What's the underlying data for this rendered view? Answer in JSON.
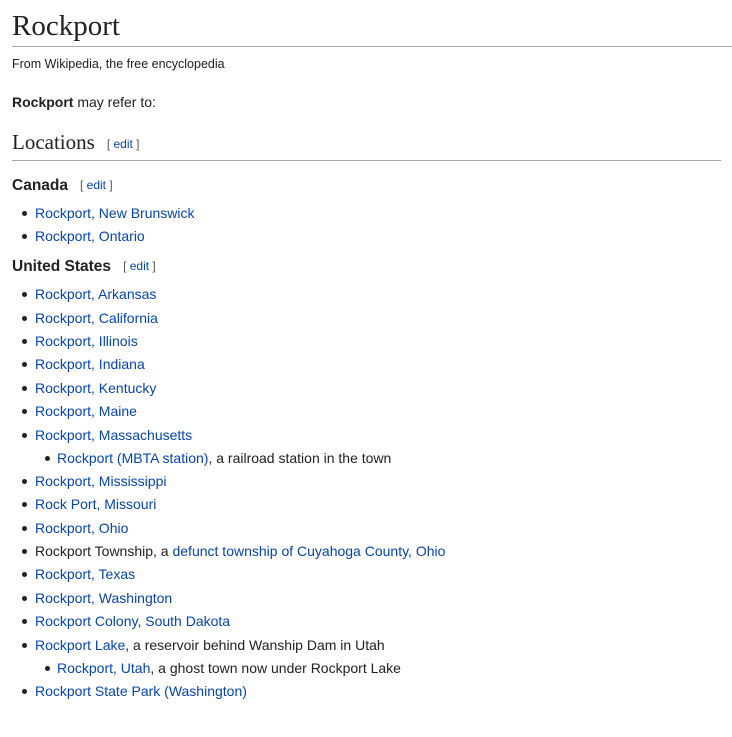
{
  "page": {
    "title": "Rockport",
    "tagline": "From Wikipedia, the free encyclopedia",
    "intro_bold": "Rockport",
    "intro_rest": " may refer to:"
  },
  "sections": {
    "locations": {
      "heading": "Locations",
      "edit_open": "[ ",
      "edit_label": "edit",
      "edit_close": " ]"
    },
    "canada": {
      "heading": "Canada",
      "edit_label": "edit",
      "items": [
        {
          "link": "Rockport, New Brunswick"
        },
        {
          "link": "Rockport, Ontario"
        }
      ]
    },
    "us": {
      "heading": "United States",
      "edit_label": "edit",
      "items": [
        {
          "link": "Rockport, Arkansas"
        },
        {
          "link": "Rockport, California"
        },
        {
          "link": "Rockport, Illinois"
        },
        {
          "link": "Rockport, Indiana"
        },
        {
          "link": "Rockport, Kentucky"
        },
        {
          "link": "Rockport, Maine"
        },
        {
          "link": "Rockport, Massachusetts",
          "sub": {
            "link": "Rockport (MBTA station)",
            "text": ", a railroad station in the town"
          }
        },
        {
          "link": "Rockport, Mississippi"
        },
        {
          "link": "Rock Port, Missouri"
        },
        {
          "link": "Rockport, Ohio"
        },
        {
          "prefix": "Rockport Township, a ",
          "link": "defunct township of Cuyahoga County, Ohio"
        },
        {
          "link": "Rockport, Texas"
        },
        {
          "link": "Rockport, Washington"
        },
        {
          "link": "Rockport Colony, South Dakota"
        },
        {
          "link": "Rockport Lake",
          "text": ", a reservoir behind Wanship Dam in Utah",
          "sub": {
            "link": "Rockport, Utah",
            "text": ", a ghost town now under Rockport Lake"
          }
        },
        {
          "link": "Rockport State Park (Washington)"
        }
      ]
    }
  }
}
